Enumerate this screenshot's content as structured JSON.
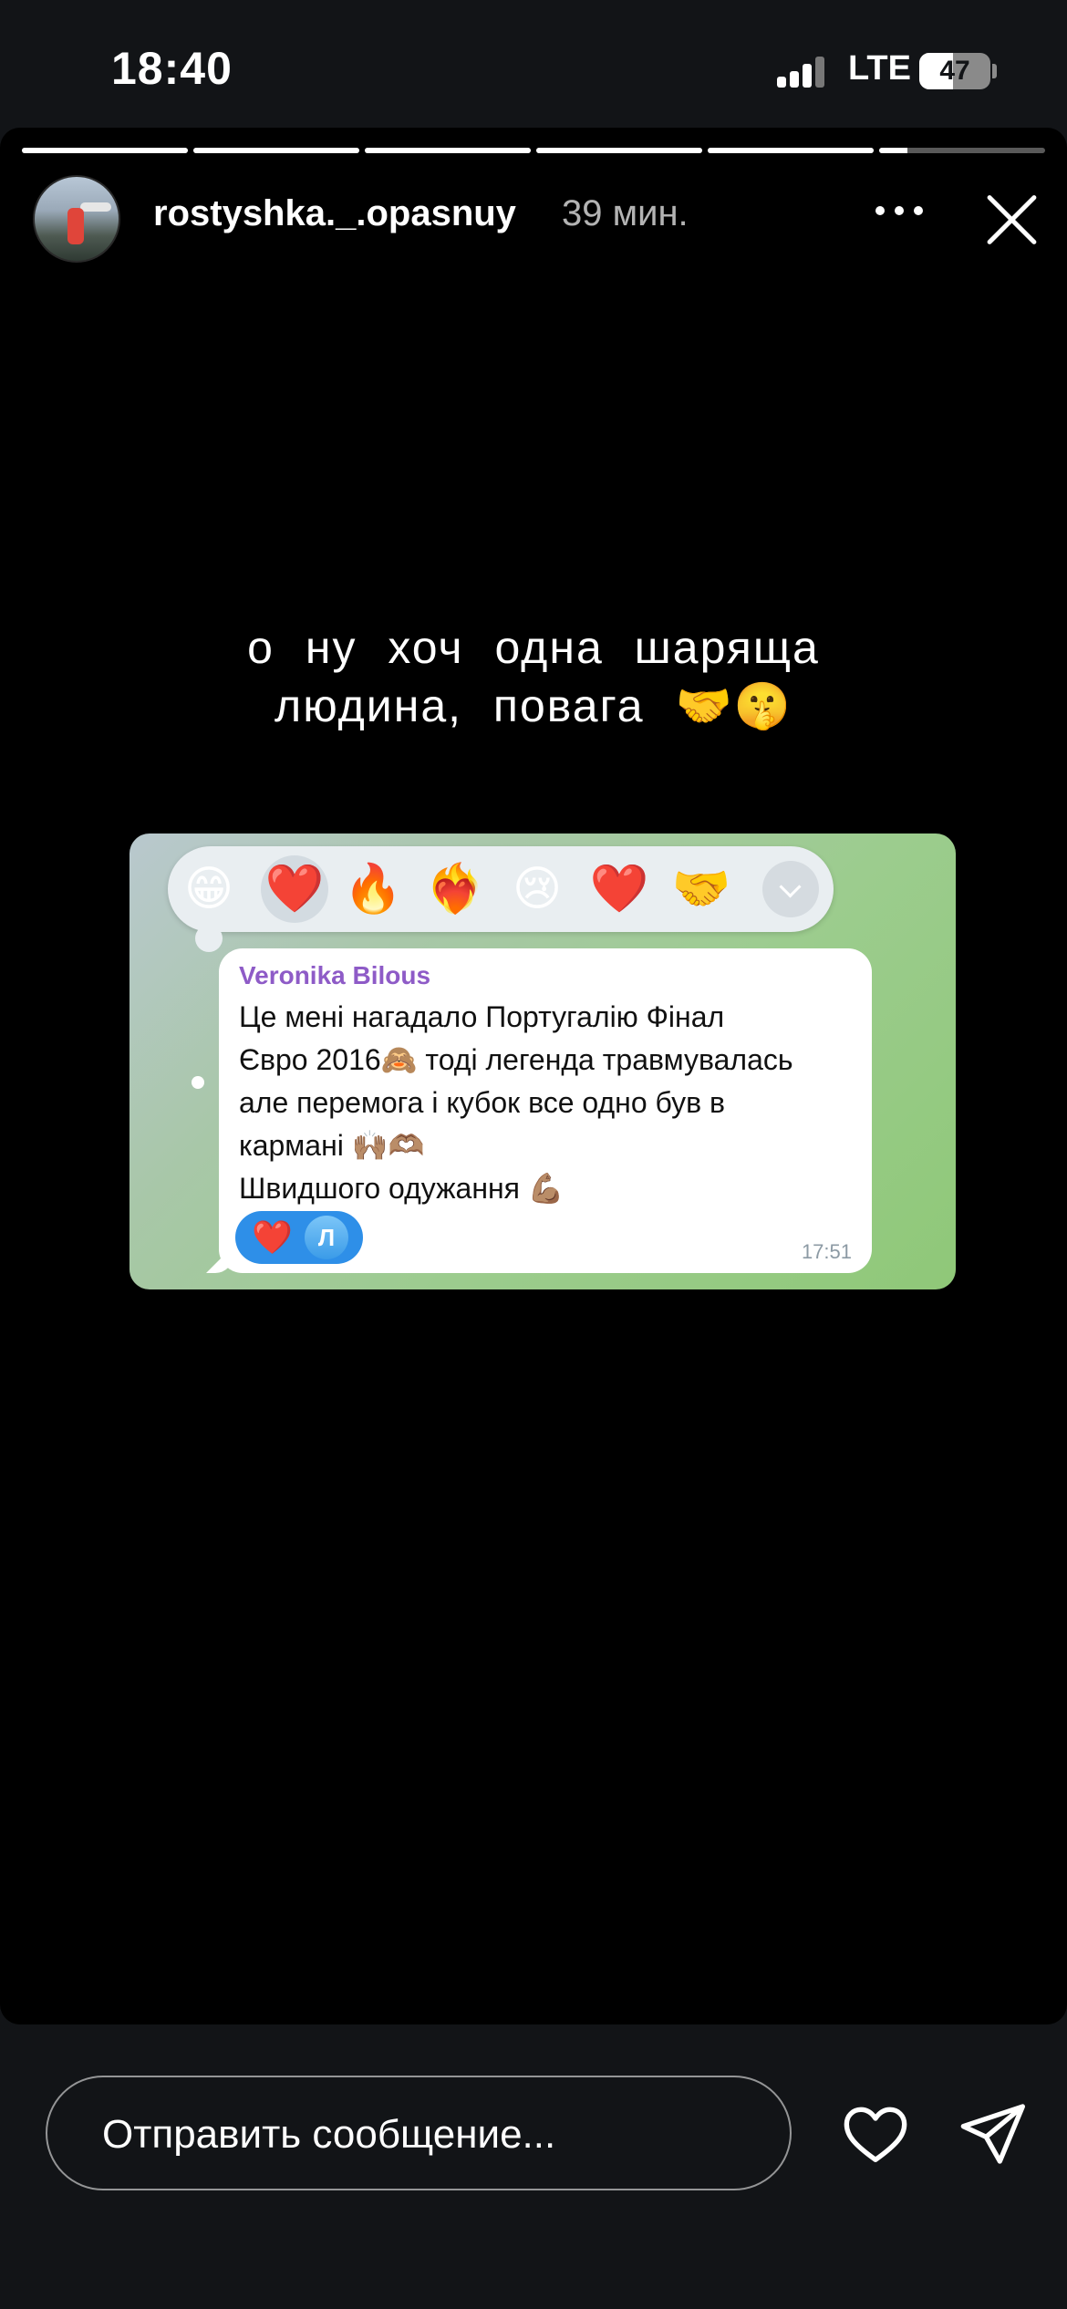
{
  "status_bar": {
    "time": "18:40",
    "network": "LTE",
    "battery_percent": "47",
    "battery_level": 0.47
  },
  "story": {
    "progress_segments": 6,
    "current_segment": 6,
    "current_progress": 0.17,
    "username": "rostyshka._.opasnuy",
    "time_ago": "39 мин.",
    "caption_line1": "о ну хоч одна шаряща",
    "caption_line2": "людина, повага 🤝🤫",
    "shared_chat": {
      "reactions": [
        "😁",
        "❤️",
        "🔥",
        "❤️‍🔥",
        "😢",
        "❤️",
        "🤝"
      ],
      "selected_reaction_index": 1,
      "sender": "Veronika Bilous",
      "message": "Це мені нагадало Португалію Фінал\nЄвро 2016🙈 тоді легенда травмувалась\nале перемога і кубок все одно був в\nкармані 🙌🏽🫶🏽\nШвидшого одужання 💪🏽",
      "reaction_pill_emoji": "❤️",
      "reaction_pill_avatar": "Л",
      "time": "17:51"
    }
  },
  "bottom_bar": {
    "input_placeholder": "Отправить сообщение..."
  },
  "icons": {
    "more": "more-horizontal-icon",
    "close": "close-icon",
    "like": "heart-icon",
    "send": "send-icon",
    "expand": "chevron-down-icon"
  }
}
